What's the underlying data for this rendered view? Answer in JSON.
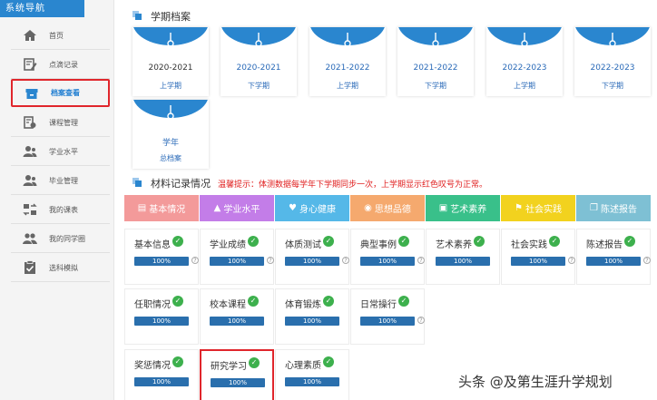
{
  "sidebar": {
    "title": "系统导航",
    "items": [
      {
        "label": "首页",
        "icon": "home-icon"
      },
      {
        "label": "点滴记录",
        "icon": "edit-icon"
      },
      {
        "label": "档案查看",
        "icon": "archive-box-icon",
        "active": true
      },
      {
        "label": "课程管理",
        "icon": "course-icon"
      },
      {
        "label": "学业水平",
        "icon": "user-icon"
      },
      {
        "label": "毕业管理",
        "icon": "user-icon"
      },
      {
        "label": "我的课表",
        "icon": "schedule-icon"
      },
      {
        "label": "我的同学圈",
        "icon": "group-icon"
      },
      {
        "label": "选科模拟",
        "icon": "checklist-icon"
      }
    ]
  },
  "semesters": {
    "title": "学期档案",
    "items": [
      {
        "year": "2020-2021",
        "term": "上学期"
      },
      {
        "year": "2020-2021",
        "term": "下学期"
      },
      {
        "year": "2021-2022",
        "term": "上学期"
      },
      {
        "year": "2021-2022",
        "term": "下学期"
      },
      {
        "year": "2022-2023",
        "term": "上学期"
      },
      {
        "year": "2022-2023",
        "term": "下学期"
      },
      {
        "year": "学年",
        "term": "总档案"
      }
    ]
  },
  "materials": {
    "title": "材料记录情况",
    "notice": "温馨提示：体测数据每学年下学期同步一次，上学期显示红色叹号为正常。",
    "tabs": [
      {
        "label": "基本情况",
        "icon": "doc-icon",
        "color": "#f39a9a"
      },
      {
        "label": "学业水平",
        "icon": "graduation-cap-icon",
        "color": "#c37de8"
      },
      {
        "label": "身心健康",
        "icon": "heart-icon",
        "color": "#55b8e8"
      },
      {
        "label": "思想品德",
        "icon": "globe-icon",
        "color": "#f5a96e"
      },
      {
        "label": "艺术素养",
        "icon": "image-icon",
        "color": "#39c08a"
      },
      {
        "label": "社会实践",
        "icon": "flag-icon",
        "color": "#f2d21e"
      },
      {
        "label": "陈述报告",
        "icon": "copy-icon",
        "color": "#7ec0d4"
      }
    ],
    "rows": [
      [
        {
          "label": "基本信息",
          "progress": "100%",
          "help": true
        },
        {
          "label": "学业成绩",
          "progress": "100%",
          "help": true
        },
        {
          "label": "体质测试",
          "progress": "100%",
          "help": true
        },
        {
          "label": "典型事例",
          "progress": "100%",
          "help": true
        },
        {
          "label": "艺术素养",
          "progress": "100%",
          "help": false
        },
        {
          "label": "社会实践",
          "progress": "100%",
          "help": true
        },
        {
          "label": "陈述报告",
          "progress": "100%",
          "help": true
        }
      ],
      [
        {
          "label": "任职情况",
          "progress": "100%",
          "help": false
        },
        {
          "label": "校本课程",
          "progress": "100%",
          "help": false
        },
        {
          "label": "体育锻炼",
          "progress": "100%",
          "help": false
        },
        {
          "label": "日常操行",
          "progress": "100%",
          "help": true
        }
      ],
      [
        {
          "label": "奖惩情况",
          "progress": "100%",
          "help": false
        },
        {
          "label": "研究学习",
          "progress": "100%",
          "help": false,
          "highlight": true
        },
        {
          "label": "心理素质",
          "progress": "100%",
          "help": false
        }
      ]
    ]
  },
  "watermark": "头条 @及第生涯升学规划"
}
